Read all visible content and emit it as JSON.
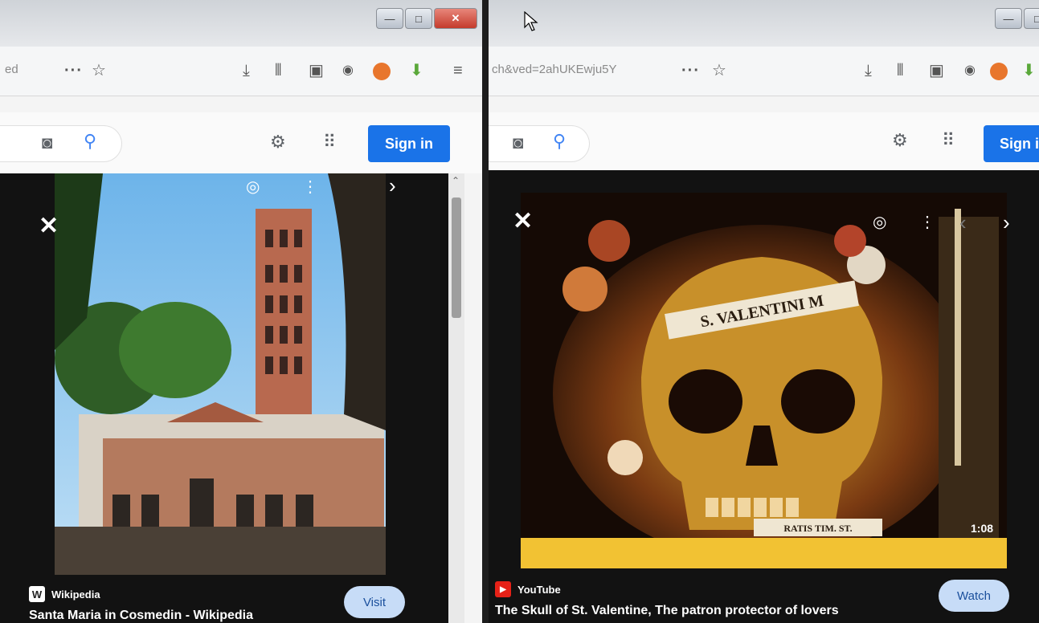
{
  "left_window": {
    "url_fragment": "ed",
    "toolbar_dots": "···",
    "signin_label": "Sign in",
    "card": {
      "source": "Wikipedia",
      "source_icon": "W",
      "title": "Santa Maria in Cosmedin - Wikipedia",
      "action_label": "Visit"
    }
  },
  "right_window": {
    "url_fragment": "ch&ved=2ahUKEwju5Y",
    "toolbar_dots": "···",
    "signin_label": "Sign i",
    "card": {
      "source": "YouTube",
      "source_icon": "▶",
      "title": "The Skull of St. Valentine, The patron protector of lovers",
      "action_label": "Watch",
      "duration": "1:08",
      "image_inscription": "S. VALENTINI M",
      "image_plaque": "RATIS TIM. ST."
    }
  },
  "window_controls": {
    "minimize": "—",
    "maximize": "□",
    "close": "✕"
  },
  "icons": {
    "star": "☆",
    "download": "⤓",
    "library": "⫴",
    "sidebar": "▣",
    "account": "◉",
    "settings": "⚙",
    "apps": "⠿",
    "camera": "◙",
    "search": "⚲",
    "close": "✕",
    "chevron_left": "‹",
    "chevron_right": "›",
    "more": "⋮",
    "lens": "◎",
    "up": "⌃"
  },
  "colors": {
    "accent": "#1a73e8",
    "youtube": "#e62117"
  }
}
